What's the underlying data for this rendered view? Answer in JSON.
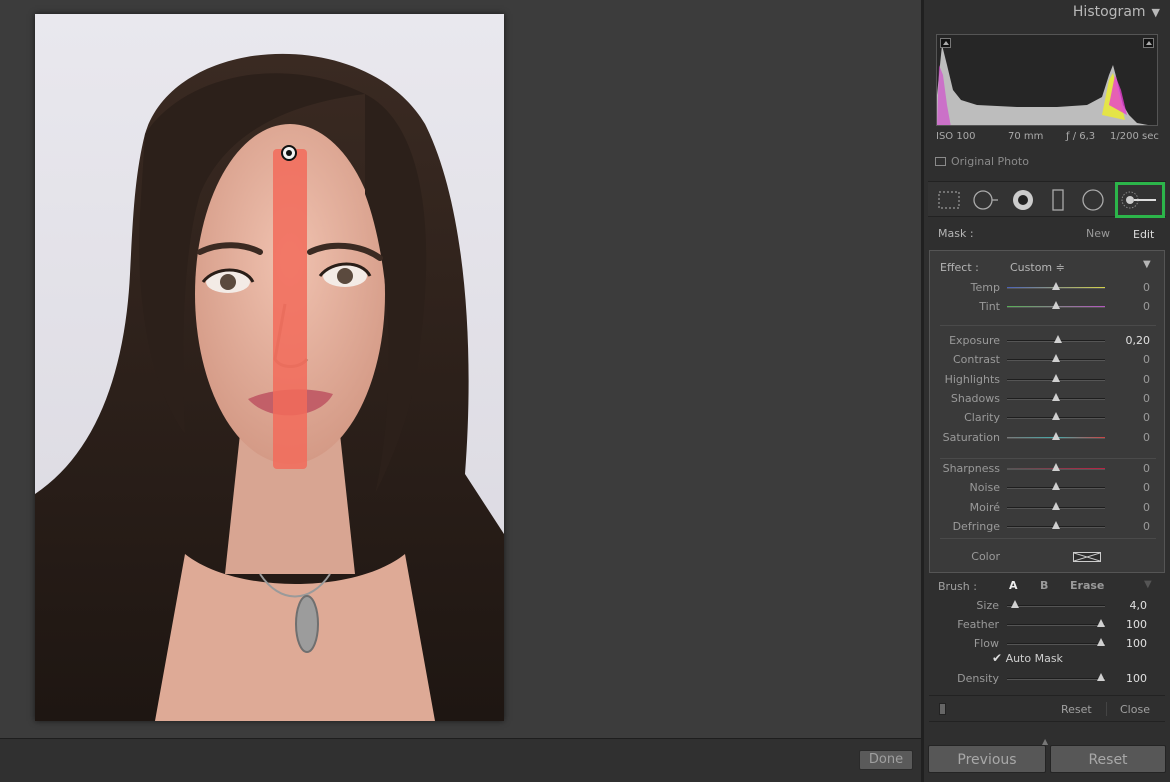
{
  "toolbar": {
    "done_label": "Done"
  },
  "panel": {
    "histogram_title": "Histogram",
    "exif": {
      "iso": "ISO 100",
      "focal": "70 mm",
      "aperture": "ƒ / 6,3",
      "shutter": "1/200 sec"
    },
    "original_photo_label": "Original Photo",
    "mask": {
      "label": "Mask :",
      "new_label": "New",
      "edit_label": "Edit"
    },
    "effect": {
      "label": "Effect :",
      "preset": "Custom ≑",
      "groups": [
        [
          {
            "name": "Temp",
            "value": "0",
            "pos": 0.5
          },
          {
            "name": "Tint",
            "value": "0",
            "pos": 0.5
          }
        ],
        [
          {
            "name": "Exposure",
            "value": "0,20",
            "pos": 0.52
          },
          {
            "name": "Contrast",
            "value": "0",
            "pos": 0.5
          },
          {
            "name": "Highlights",
            "value": "0",
            "pos": 0.5
          },
          {
            "name": "Shadows",
            "value": "0",
            "pos": 0.5
          },
          {
            "name": "Clarity",
            "value": "0",
            "pos": 0.5
          },
          {
            "name": "Saturation",
            "value": "0",
            "pos": 0.5
          }
        ],
        [
          {
            "name": "Sharpness",
            "value": "0",
            "pos": 0.5
          },
          {
            "name": "Noise",
            "value": "0",
            "pos": 0.5
          },
          {
            "name": "Moiré",
            "value": "0",
            "pos": 0.5
          },
          {
            "name": "Defringe",
            "value": "0",
            "pos": 0.5
          }
        ]
      ],
      "color_label": "Color"
    },
    "brush": {
      "label": "Brush :",
      "a_label": "A",
      "b_label": "B",
      "erase_label": "Erase",
      "size": {
        "name": "Size",
        "value": "4,0",
        "pos": 0.08
      },
      "feather": {
        "name": "Feather",
        "value": "100",
        "pos": 1.0
      },
      "flow": {
        "name": "Flow",
        "value": "100",
        "pos": 1.0
      },
      "auto_mask_label": "Auto Mask",
      "auto_mask_checked": true,
      "density": {
        "name": "Density",
        "value": "100",
        "pos": 1.0
      }
    },
    "reset_label": "Reset",
    "close_label": "Close",
    "previous_label": "Previous",
    "reset_button_label": "Reset"
  }
}
